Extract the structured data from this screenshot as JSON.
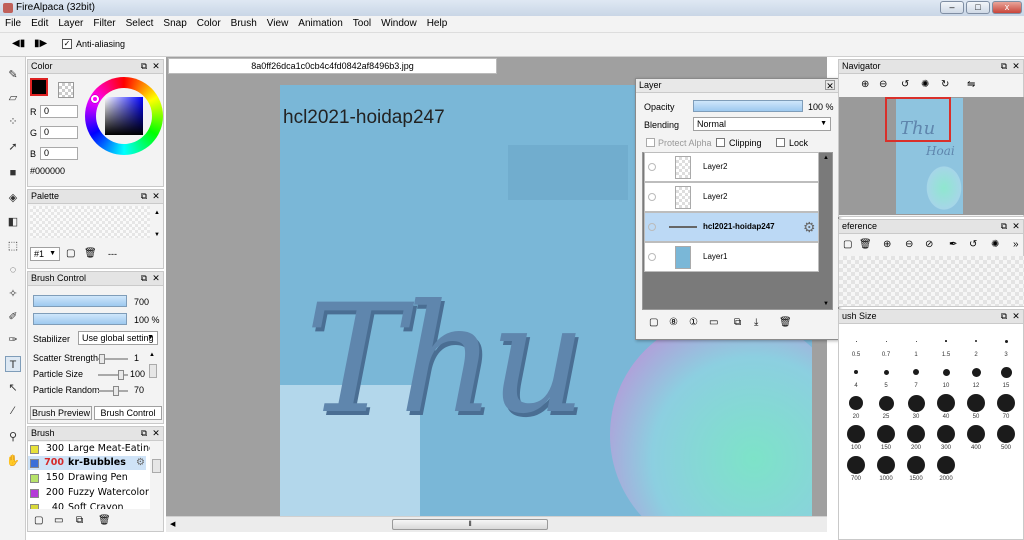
{
  "window": {
    "title": "FireAlpaca (32bit)",
    "minimize": "–",
    "maximize": "□",
    "close": "x"
  },
  "menu": [
    "File",
    "Edit",
    "Layer",
    "Filter",
    "Select",
    "Snap",
    "Color",
    "Brush",
    "View",
    "Animation",
    "Tool",
    "Window",
    "Help"
  ],
  "toolbar": {
    "antialias_label": "Anti-aliasing",
    "antialias_checked": true
  },
  "color_panel": {
    "title": "Color",
    "r_label": "R",
    "r_value": "0",
    "g_label": "G",
    "g_value": "0",
    "b_label": "B",
    "b_value": "0",
    "hex": "#000000",
    "primary_color": "#000000"
  },
  "palette_panel": {
    "title": "Palette",
    "select_value": "#1",
    "dashes": "---"
  },
  "brush_control": {
    "title": "Brush Control",
    "size_value": "700",
    "opacity_value": "100 %",
    "stabilizer_label": "Stabilizer",
    "stabilizer_value": "Use global setting",
    "scatter_label": "Scatter Strength",
    "scatter_value": "1",
    "particle_size_label": "Particle Size",
    "particle_size_value": "100",
    "particle_random_label": "Particle Random",
    "particle_random_value": "70",
    "tab_preview": "Brush Preview",
    "tab_control": "Brush Control"
  },
  "brush_panel": {
    "title": "Brush",
    "items": [
      {
        "size": "300",
        "name": "Large Meat-Eating I",
        "color": "#e8e23a"
      },
      {
        "size": "700",
        "name": "kr-Bubbles",
        "color": "#3a6fd8",
        "selected": true
      },
      {
        "size": "150",
        "name": "Drawing Pen",
        "color": "#b7e36a"
      },
      {
        "size": "200",
        "name": "Fuzzy Watercolor",
        "color": "#b43ad8"
      },
      {
        "size": "40",
        "name": "Soft Crayon",
        "color": "#d8d83a"
      }
    ]
  },
  "document": {
    "tab_title": "8a0ff26dca1c0cb4c4fd0842af8496b3.jpg",
    "canvas_text": "hcl2021-hoidap247",
    "lettering": "Thu",
    "bg_color": "#7ab7d7"
  },
  "layer_panel": {
    "title": "Layer",
    "opacity_label": "Opacity",
    "opacity_value": "100 %",
    "blending_label": "Blending",
    "blending_value": "Normal",
    "protect_alpha": "Protect Alpha",
    "clipping": "Clipping",
    "lock": "Lock",
    "layers": [
      {
        "name": "Layer2",
        "selected": false
      },
      {
        "name": "Layer2",
        "selected": false
      },
      {
        "name": "hcl2021-hoidap247",
        "selected": true
      },
      {
        "name": "Layer1",
        "selected": false
      }
    ]
  },
  "navigator_panel": {
    "title": "Navigator",
    "preview_text1": "Thu",
    "preview_text2": "Hoai"
  },
  "reference_panel": {
    "title": "eference"
  },
  "brush_size_panel": {
    "title": "ush Size",
    "sizes": [
      "0.5",
      "0.7",
      "1",
      "1.5",
      "2",
      "3",
      "4",
      "5",
      "7",
      "10",
      "12",
      "15",
      "20",
      "25",
      "30",
      "40",
      "50",
      "70",
      "100",
      "150",
      "200",
      "300",
      "400",
      "500",
      "700",
      "1000",
      "1500",
      "2000"
    ]
  }
}
